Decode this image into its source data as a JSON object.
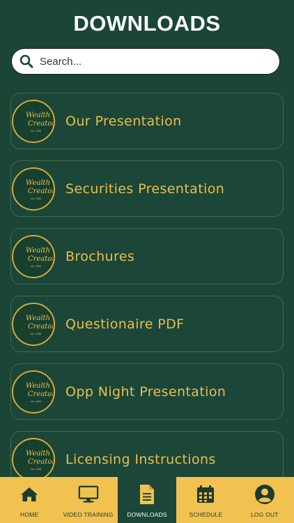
{
  "header": {
    "title": "DOWNLOADS"
  },
  "search": {
    "placeholder": "Search...",
    "icon": "search-icon"
  },
  "downloads": [
    {
      "label": "Our Presentation"
    },
    {
      "label": "Securities Presentation"
    },
    {
      "label": "Brochures"
    },
    {
      "label": "Questionaire PDF"
    },
    {
      "label": "Opp Night Presentation"
    },
    {
      "label": "Licensing Instructions"
    }
  ],
  "logo": {
    "line1": "Wealth",
    "line2": "Creators",
    "line3": "est. 1996"
  },
  "tabbar": {
    "home": "HOME",
    "video_training": "VIDEO TRAINING",
    "downloads": "DOWNLOADS",
    "schedule": "SCHEDULE",
    "log_out": "LOG OUT",
    "active": "downloads"
  },
  "colors": {
    "background": "#1b4636",
    "accent": "#e9bf4c",
    "tabbar": "#f1c24f",
    "card_border": "#3f6a52"
  }
}
